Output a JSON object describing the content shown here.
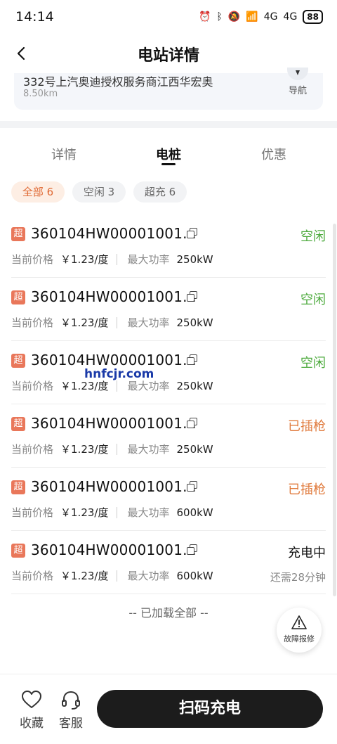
{
  "status_bar": {
    "time": "14:14",
    "network": "4G",
    "network2": "4G",
    "battery": "88"
  },
  "header": {
    "title": "电站详情"
  },
  "station": {
    "address": "332号上汽奥迪授权服务商江西华宏奥",
    "distance": "8.50km",
    "nav_label": "导航"
  },
  "tabs": [
    {
      "label": "详情"
    },
    {
      "label": "电桩"
    },
    {
      "label": "优惠"
    }
  ],
  "filters": [
    {
      "label": "全部 6"
    },
    {
      "label": "空闲 3"
    },
    {
      "label": "超充 6"
    }
  ],
  "pile_labels": {
    "badge": "超",
    "price_label": "当前价格",
    "power_label": "最大功率"
  },
  "piles": [
    {
      "id": "360104HW00001001...",
      "status": "空闲",
      "price": "￥1.23/度",
      "power": "250kW",
      "remain": ""
    },
    {
      "id": "360104HW00001001...",
      "status": "空闲",
      "price": "￥1.23/度",
      "power": "250kW",
      "remain": ""
    },
    {
      "id": "360104HW00001001...",
      "status": "空闲",
      "price": "￥1.23/度",
      "power": "250kW",
      "remain": ""
    },
    {
      "id": "360104HW00001001...",
      "status": "已插枪",
      "price": "￥1.23/度",
      "power": "250kW",
      "remain": ""
    },
    {
      "id": "360104HW00001001...",
      "status": "已插枪",
      "price": "￥1.23/度",
      "power": "600kW",
      "remain": ""
    },
    {
      "id": "360104HW00001001...",
      "status": "充电中",
      "price": "￥1.23/度",
      "power": "600kW",
      "remain": "还需28分钟"
    }
  ],
  "list_footer": "-- 已加载全部 --",
  "fault_button": {
    "label": "故障报修"
  },
  "bottom_bar": {
    "favorite_label": "收藏",
    "service_label": "客服",
    "scan_label": "扫码充电"
  },
  "watermark": "hnfcjr.com",
  "colors": {
    "idle": "#4caa3c",
    "plugged": "#e07a3c",
    "charging": "#111111",
    "badge": "#e9775a",
    "accent": "#e06a35"
  }
}
